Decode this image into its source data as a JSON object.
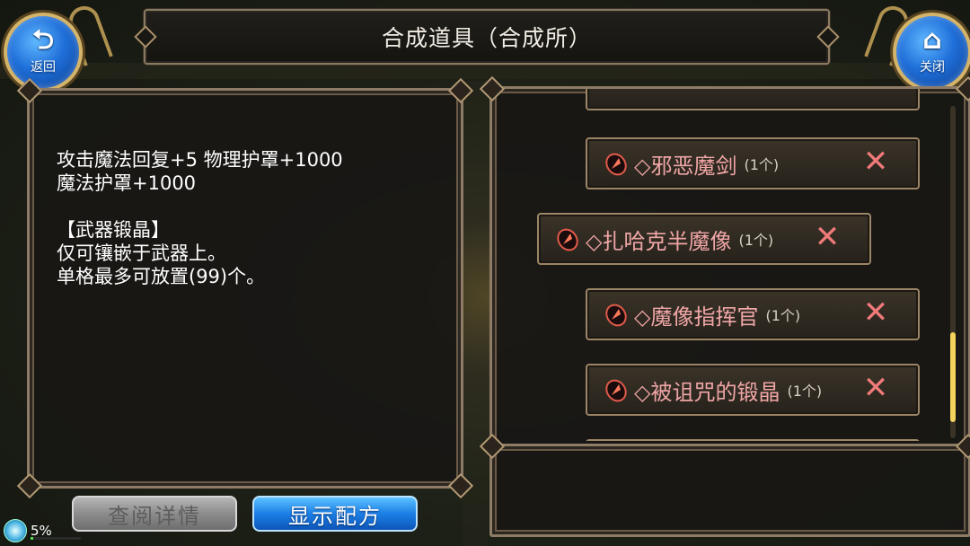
{
  "header": {
    "title": "合成道具（合成所）"
  },
  "nav": {
    "back_label": "返回",
    "back_icon": "return-arrow-icon",
    "close_label": "关闭",
    "close_icon": "home-icon"
  },
  "description": {
    "lines": [
      "攻击魔法回复+5 物理护罩+1000",
      "魔法护罩+1000",
      "",
      "【武器锻晶】",
      "仅可镶嵌于武器上。",
      "单格最多可放置(99)个。"
    ]
  },
  "buttons": {
    "detail_label": "查阅详情",
    "recipe_label": "显示配方"
  },
  "status": {
    "percent_text": "5%",
    "progress": 0.05
  },
  "list": {
    "items": [
      {
        "name": "◇邪恶魔剑",
        "qty": "(1个)",
        "remove": "✕"
      },
      {
        "name": "◇扎哈克半魔像",
        "qty": "(1个)",
        "remove": "✕",
        "selected": true
      },
      {
        "name": "◇魔像指挥官",
        "qty": "(1个)",
        "remove": "✕"
      },
      {
        "name": "◇被诅咒的锻晶",
        "qty": "(1个)",
        "remove": "✕"
      }
    ]
  },
  "colors": {
    "item_text": "#f0a6a6",
    "remove_icon": "#f07a7a",
    "scroll_thumb": "#f3d35c",
    "recipe_button": "#1c7fe6",
    "detail_button": "#8c8c8c"
  }
}
